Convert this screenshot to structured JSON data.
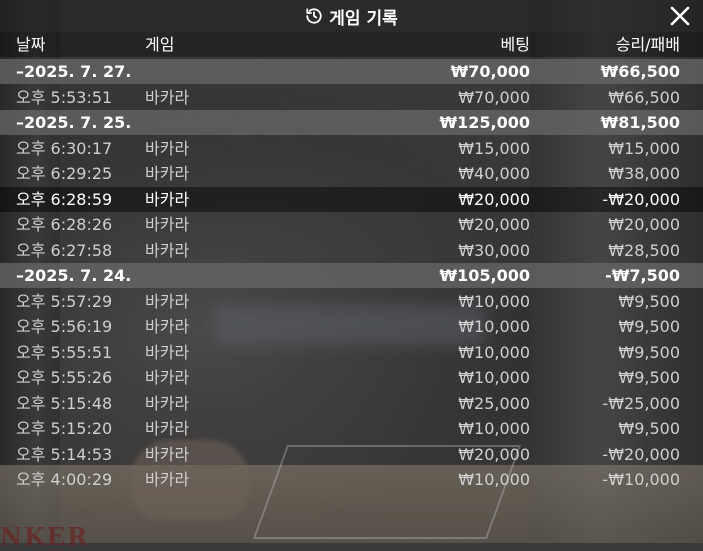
{
  "title": "게임 기록",
  "columns": {
    "date": "날짜",
    "game": "게임",
    "bet": "베팅",
    "result": "승리/패배"
  },
  "rows": [
    {
      "type": "group",
      "time": "–2025. 7. 27.",
      "game": "",
      "bet": "₩70,000",
      "result": "₩66,500"
    },
    {
      "type": "item",
      "time": "오후 5:53:51",
      "game": "바카라",
      "bet": "₩70,000",
      "result": "₩66,500"
    },
    {
      "type": "group",
      "time": "–2025. 7. 25.",
      "game": "",
      "bet": "₩125,000",
      "result": "₩81,500"
    },
    {
      "type": "item",
      "time": "오후 6:30:17",
      "game": "바카라",
      "bet": "₩15,000",
      "result": "₩15,000"
    },
    {
      "type": "item",
      "time": "오후 6:29:25",
      "game": "바카라",
      "bet": "₩40,000",
      "result": "₩38,000"
    },
    {
      "type": "selected",
      "time": "오후 6:28:59",
      "game": "바카라",
      "bet": "₩20,000",
      "result": "-₩20,000"
    },
    {
      "type": "item",
      "time": "오후 6:28:26",
      "game": "바카라",
      "bet": "₩20,000",
      "result": "₩20,000"
    },
    {
      "type": "item",
      "time": "오후 6:27:58",
      "game": "바카라",
      "bet": "₩30,000",
      "result": "₩28,500"
    },
    {
      "type": "group",
      "time": "–2025. 7. 24.",
      "game": "",
      "bet": "₩105,000",
      "result": "-₩7,500"
    },
    {
      "type": "item",
      "time": "오후 5:57:29",
      "game": "바카라",
      "bet": "₩10,000",
      "result": "₩9,500"
    },
    {
      "type": "item",
      "time": "오후 5:56:19",
      "game": "바카라",
      "bet": "₩10,000",
      "result": "₩9,500"
    },
    {
      "type": "item",
      "time": "오후 5:55:51",
      "game": "바카라",
      "bet": "₩10,000",
      "result": "₩9,500"
    },
    {
      "type": "item",
      "time": "오후 5:55:26",
      "game": "바카라",
      "bet": "₩10,000",
      "result": "₩9,500"
    },
    {
      "type": "item",
      "time": "오후 5:15:48",
      "game": "바카라",
      "bet": "₩25,000",
      "result": "-₩25,000"
    },
    {
      "type": "item",
      "time": "오후 5:15:20",
      "game": "바카라",
      "bet": "₩10,000",
      "result": "₩9,500"
    },
    {
      "type": "item",
      "time": "오후 5:14:53",
      "game": "바카라",
      "bet": "₩20,000",
      "result": "-₩20,000"
    },
    {
      "type": "item",
      "time": "오후 4:00:29",
      "game": "바카라",
      "bet": "₩10,000",
      "result": "-₩10,000"
    }
  ],
  "background_text": "NKER",
  "icons": {
    "title": "history-icon",
    "close": "close-icon"
  }
}
